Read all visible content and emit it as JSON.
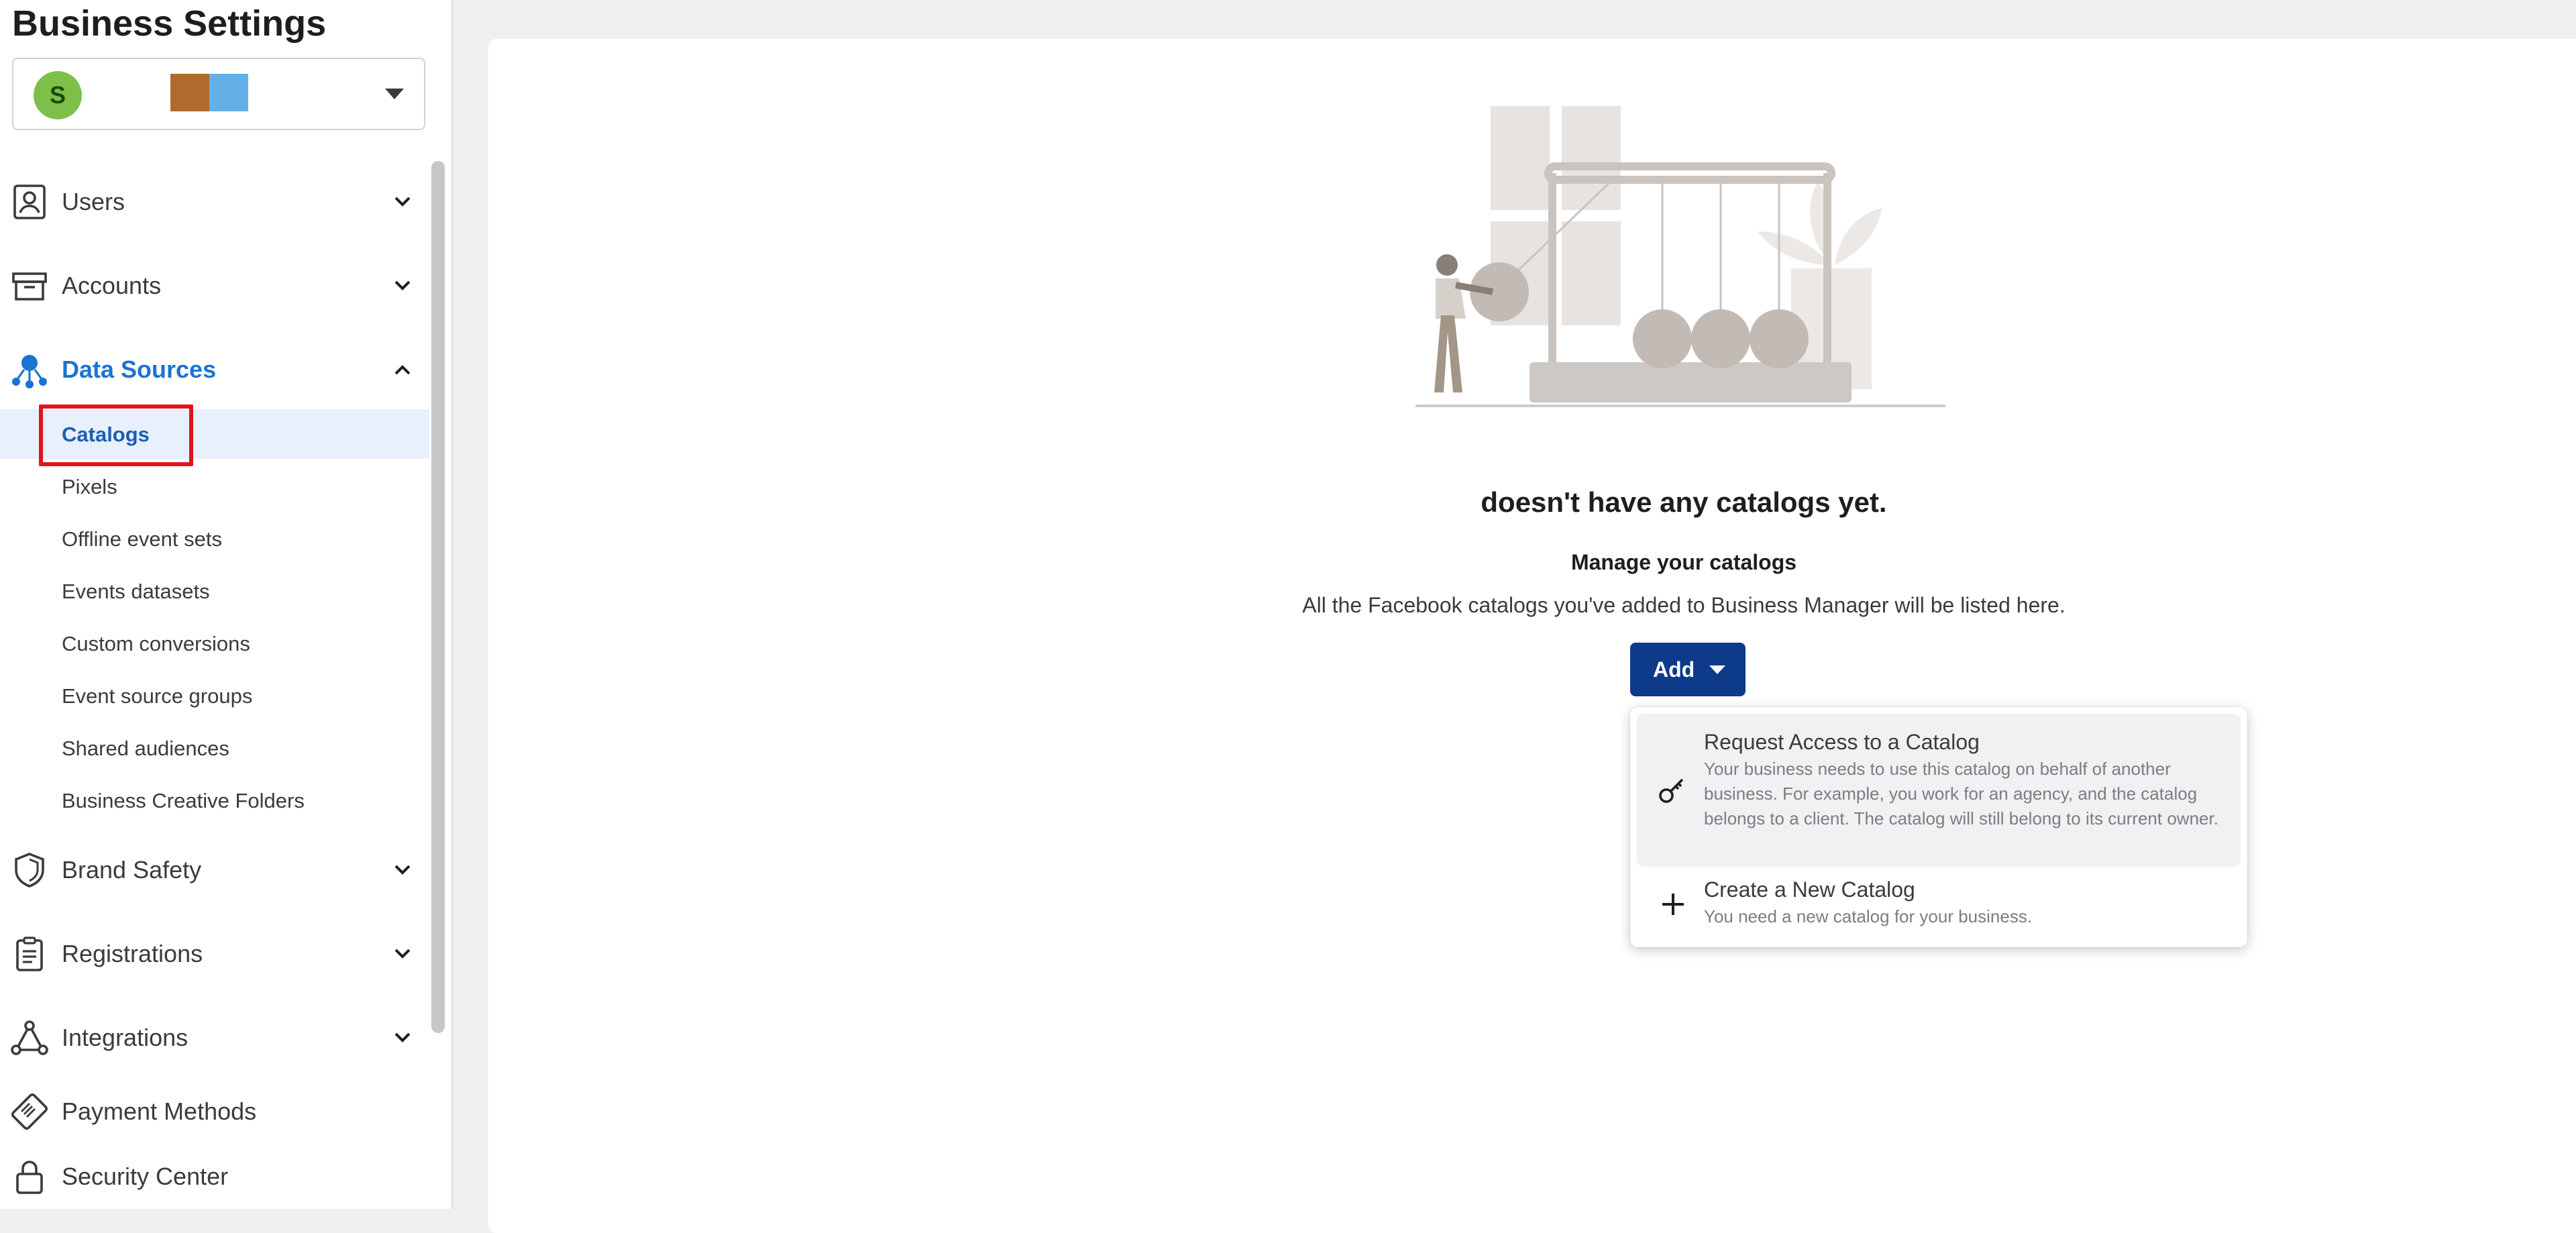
{
  "sidebar": {
    "title": "Business Settings",
    "business": {
      "avatar_letter": "S"
    },
    "nav": {
      "users": "Users",
      "accounts": "Accounts",
      "data_sources": "Data Sources",
      "brand_safety": "Brand Safety",
      "registrations": "Registrations",
      "integrations": "Integrations",
      "payment_methods": "Payment Methods",
      "security_center": "Security Center"
    },
    "data_sources_items": [
      "Catalogs",
      "Pixels",
      "Offline event sets",
      "Events datasets",
      "Custom conversions",
      "Event source groups",
      "Shared audiences",
      "Business Creative Folders"
    ],
    "selected_item": "Catalogs"
  },
  "main": {
    "empty_title": "doesn't have any catalogs yet.",
    "empty_subtitle": "Manage your catalogs",
    "empty_description": "All the Facebook catalogs you've added to Business Manager will be listed here.",
    "add_button": "Add",
    "dropdown": [
      {
        "title": "Request Access to a Catalog",
        "description": "Your business needs to use this catalog on behalf of another business. For example, you work for an agency, and the catalog belongs to a client. The catalog will still belong to its current owner.",
        "icon": "key-icon"
      },
      {
        "title": "Create a New Catalog",
        "description": "You need a new catalog for your business.",
        "icon": "plus-icon"
      }
    ]
  },
  "colors": {
    "accent": "#1a73d1",
    "button": "#0e3a8a",
    "highlight": "#e0141e",
    "selected_bg": "#e7f0fc"
  }
}
